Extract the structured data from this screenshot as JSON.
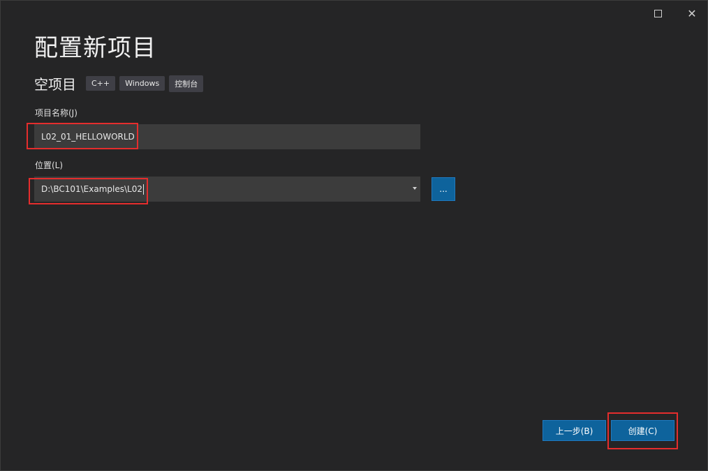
{
  "header": {
    "title": "配置新项目",
    "template_name": "空项目",
    "tags": [
      "C++",
      "Windows",
      "控制台"
    ]
  },
  "project_name": {
    "label": "项目名称(J)",
    "value": "L02_01_HELLOWORLD"
  },
  "location": {
    "label": "位置(L)",
    "value": "D:\\BC101\\Examples\\L02",
    "browse_label": "..."
  },
  "footer": {
    "back_label": "上一步(B)",
    "create_label": "创建(C)"
  },
  "window_controls": {
    "maximize_icon": "maximize-icon",
    "close_icon": "close-icon",
    "close_glyph": "✕"
  },
  "colors": {
    "background": "#252526",
    "input_background": "#3c3c3c",
    "accent": "#0e639c",
    "highlight": "#e52d2d"
  }
}
